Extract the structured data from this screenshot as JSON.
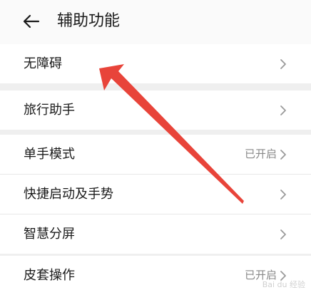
{
  "header": {
    "back_icon": "arrow-left-icon",
    "title": "辅助功能"
  },
  "groups": [
    {
      "items": [
        {
          "label": "无障碍",
          "value": ""
        }
      ]
    },
    {
      "items": [
        {
          "label": "旅行助手",
          "value": ""
        }
      ]
    },
    {
      "items": [
        {
          "label": "单手模式",
          "value": "已开启"
        },
        {
          "label": "快捷启动及手势",
          "value": ""
        },
        {
          "label": "智慧分屏",
          "value": ""
        }
      ]
    },
    {
      "items": [
        {
          "label": "皮套操作",
          "value": "已开启"
        }
      ]
    }
  ],
  "annotation": {
    "arrow_color": "#e8443a"
  },
  "watermark": "Bai du 经验"
}
